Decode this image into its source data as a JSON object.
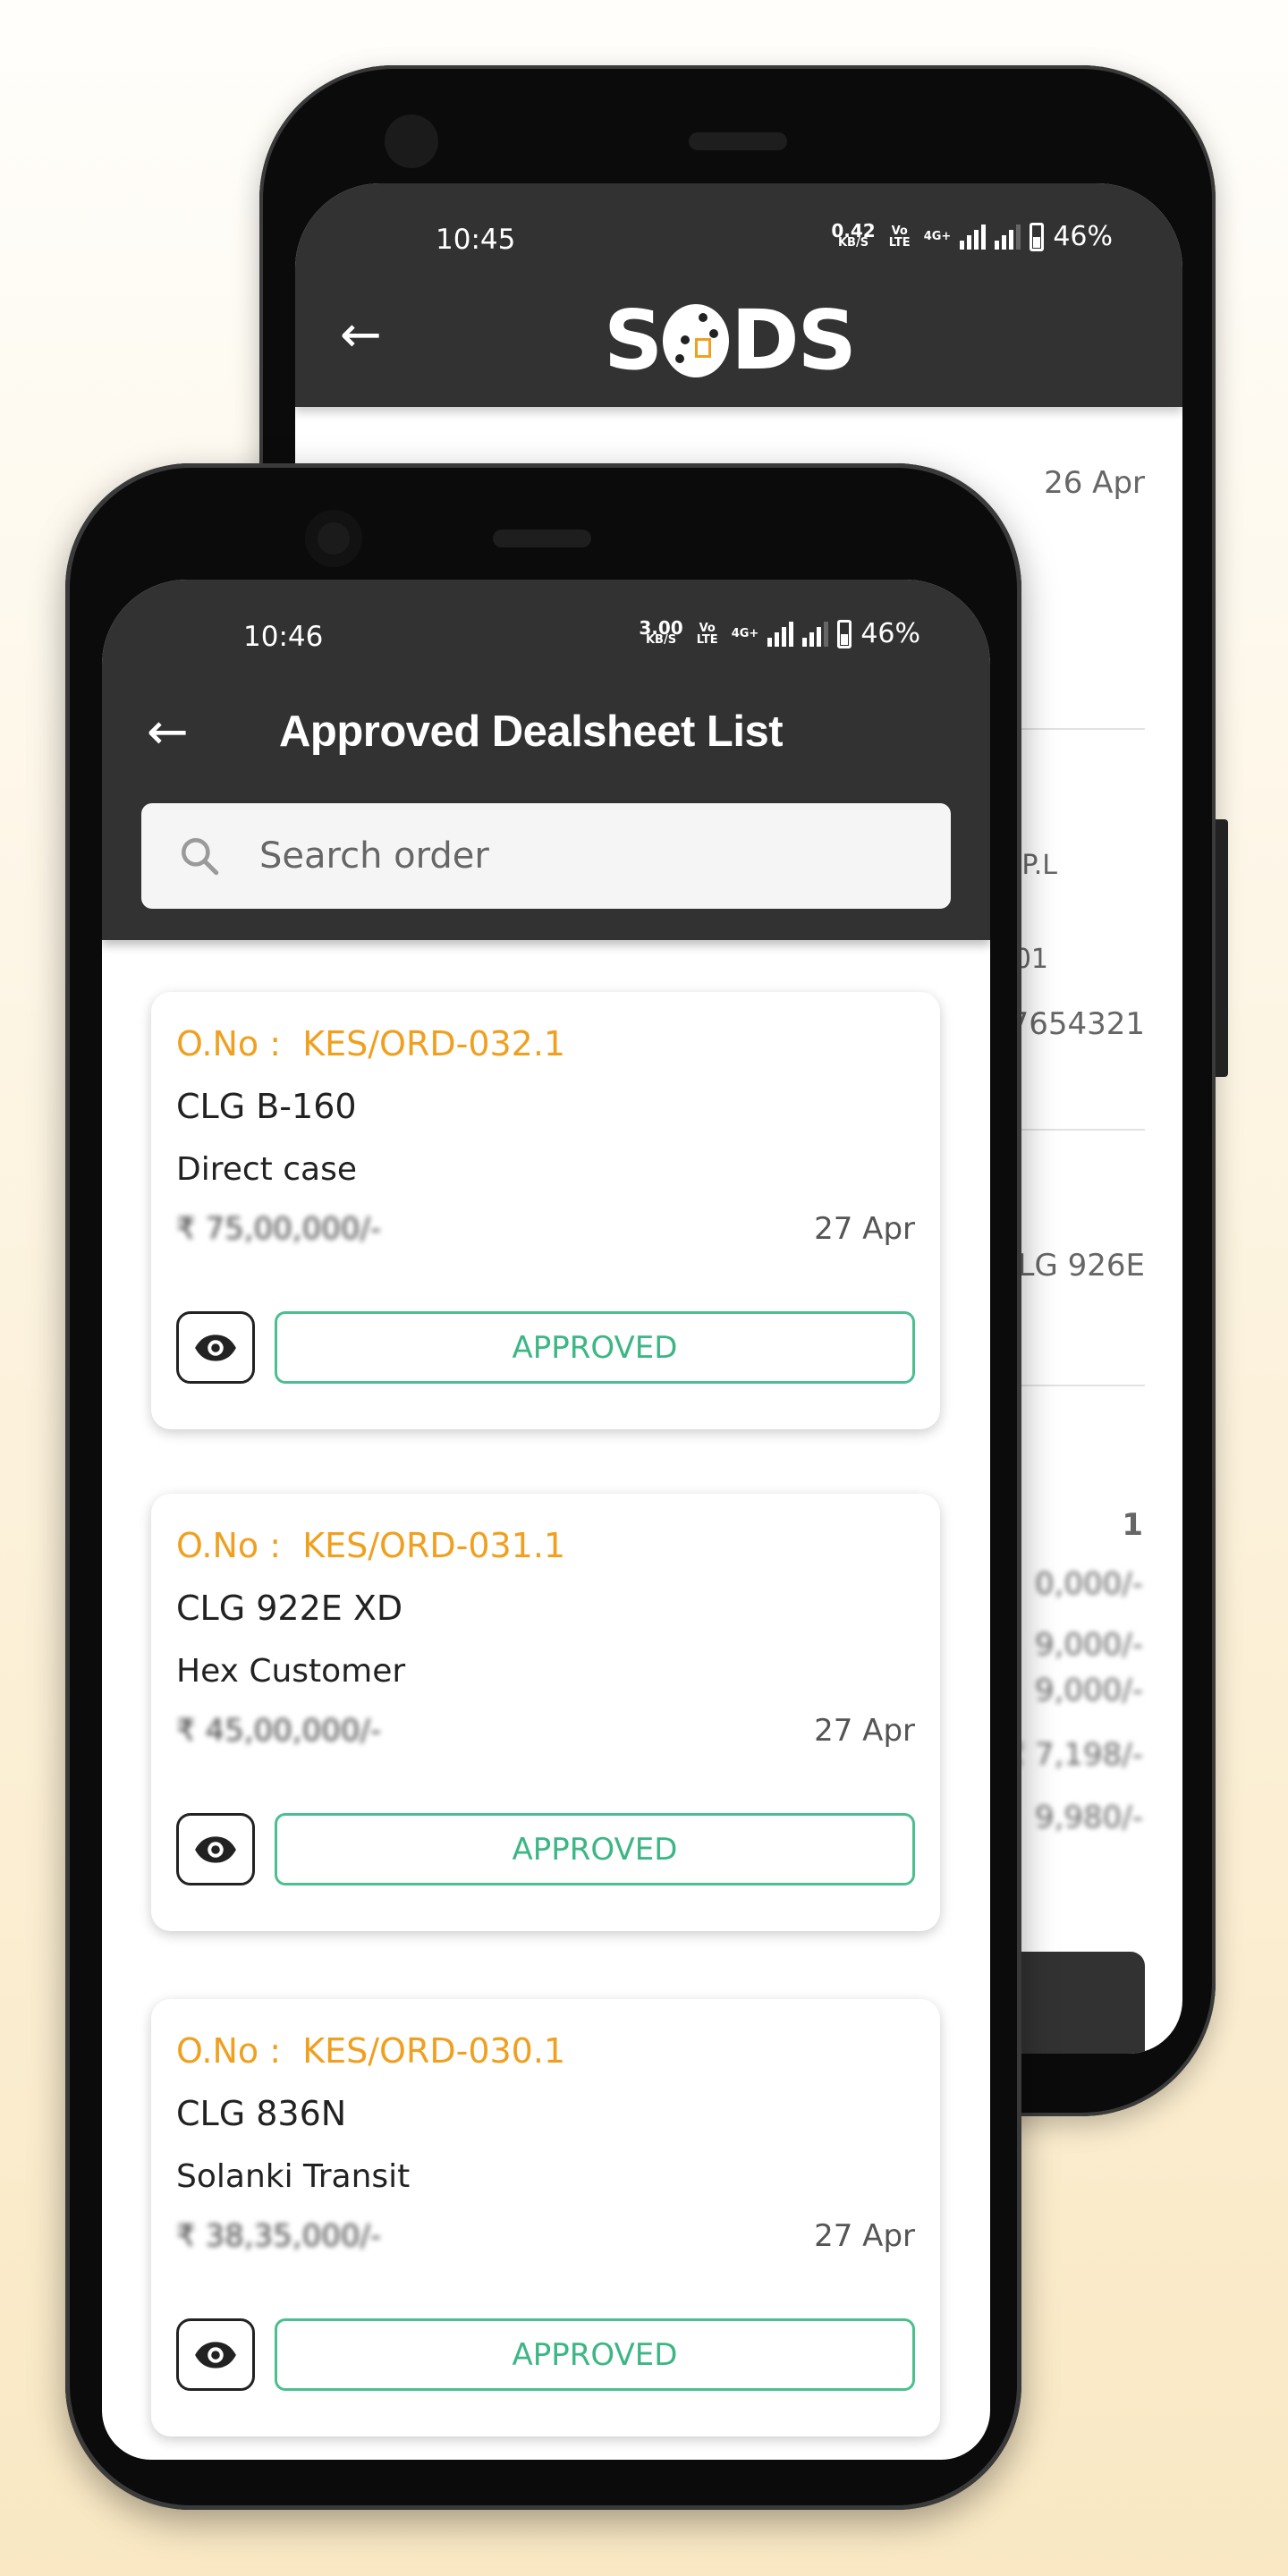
{
  "colors": {
    "accent": "#f0a020",
    "approved": "#3cb684",
    "header": "#323232"
  },
  "back_phone": {
    "status_bar": {
      "time": "10:45",
      "speed": "0.42",
      "speed_unit": "KB/S",
      "volte": "Vo LTE",
      "network": "4G+",
      "battery": "46%"
    },
    "header": {
      "logo": "SODS",
      "back_icon": "arrow-left-icon"
    },
    "content": {
      "date": "26 Apr",
      "partial_lines": [
        "P.L",
        "01",
        "7654321",
        "LG 926E",
        "1"
      ],
      "blurred_amounts": [
        "0,000/-",
        "9,000/-",
        "9,000/-",
        "₹ 7,198/-",
        "9,980/-"
      ]
    }
  },
  "front_phone": {
    "status_bar": {
      "time": "10:46",
      "speed": "3.00",
      "speed_unit": "KB/S",
      "volte": "Vo LTE",
      "network": "4G+",
      "battery": "46%"
    },
    "header": {
      "title": "Approved Dealsheet List",
      "back_icon": "arrow-left-icon"
    },
    "search": {
      "placeholder": "Search order",
      "value": ""
    },
    "orders": [
      {
        "order_label": "O.No :",
        "order_no": "KES/ORD-032.1",
        "model": "CLG B-160",
        "customer": "Direct case",
        "amount": "₹ 75,00,000/-",
        "date": "27 Apr",
        "status": "APPROVED"
      },
      {
        "order_label": "O.No :",
        "order_no": "KES/ORD-031.1",
        "model": "CLG 922E XD",
        "customer": "Hex Customer",
        "amount": "₹ 45,00,000/-",
        "date": "27 Apr",
        "status": "APPROVED"
      },
      {
        "order_label": "O.No :",
        "order_no": "KES/ORD-030.1",
        "model": "CLG 836N",
        "customer": "Solanki Transit",
        "amount": "₹ 38,35,000/-",
        "date": "27 Apr",
        "status": "APPROVED"
      }
    ]
  }
}
